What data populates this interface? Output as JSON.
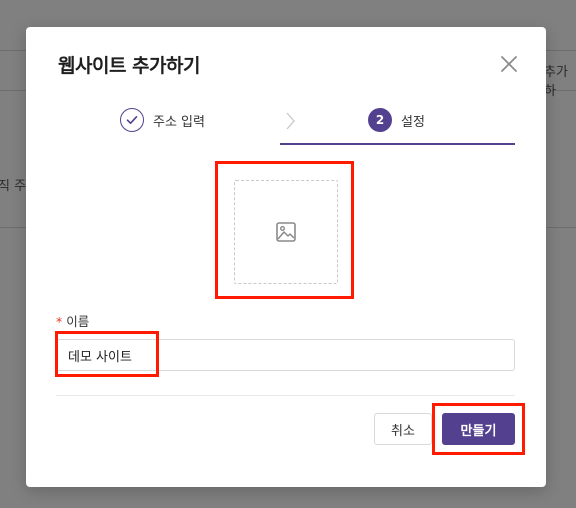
{
  "background": {
    "right_fragment": "추가하",
    "left_fragment": "직 주"
  },
  "modal": {
    "title": "웹사이트 추가하기",
    "steps": [
      {
        "label": "주소 입력",
        "status": "done"
      },
      {
        "number": "2",
        "label": "설정",
        "status": "active"
      }
    ],
    "name_field": {
      "label": "이름",
      "required_mark": "*",
      "value": "데모 사이트"
    },
    "buttons": {
      "cancel": "취소",
      "create": "만들기"
    }
  },
  "colors": {
    "accent": "#53408f",
    "highlight": "#ff1a00",
    "required": "#e6382f"
  }
}
